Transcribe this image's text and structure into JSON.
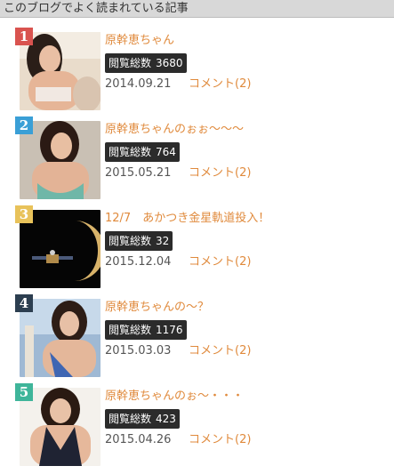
{
  "widget": {
    "title": "このブログでよく読まれている記事"
  },
  "ranking": [
    {
      "rank": "1",
      "badge_color": "#d9534f",
      "title": "原幹恵ちゃん",
      "views_label": "閲覧総数",
      "views": "3680",
      "date": "2014.09.21",
      "comments": "コメント(2)"
    },
    {
      "rank": "2",
      "badge_color": "#3a9fd6",
      "title": "原幹恵ちゃんのぉぉ～～～",
      "views_label": "閲覧総数",
      "views": "764",
      "date": "2015.05.21",
      "comments": "コメント(2)"
    },
    {
      "rank": "3",
      "badge_color": "#e8c25a",
      "title": "12/7　あかつき金星軌道投入！",
      "views_label": "閲覧総数",
      "views": "32",
      "date": "2015.12.04",
      "comments": "コメント(2)"
    },
    {
      "rank": "4",
      "badge_color": "#2c3e50",
      "title": "原幹恵ちゃんの～？",
      "views_label": "閲覧総数",
      "views": "1176",
      "date": "2015.03.03",
      "comments": "コメント(2)"
    },
    {
      "rank": "5",
      "badge_color": "#3fb59a",
      "title": "原幹恵ちゃんのぉ～・・・",
      "views_label": "閲覧総数",
      "views": "423",
      "date": "2015.04.26",
      "comments": "コメント(2)"
    }
  ]
}
